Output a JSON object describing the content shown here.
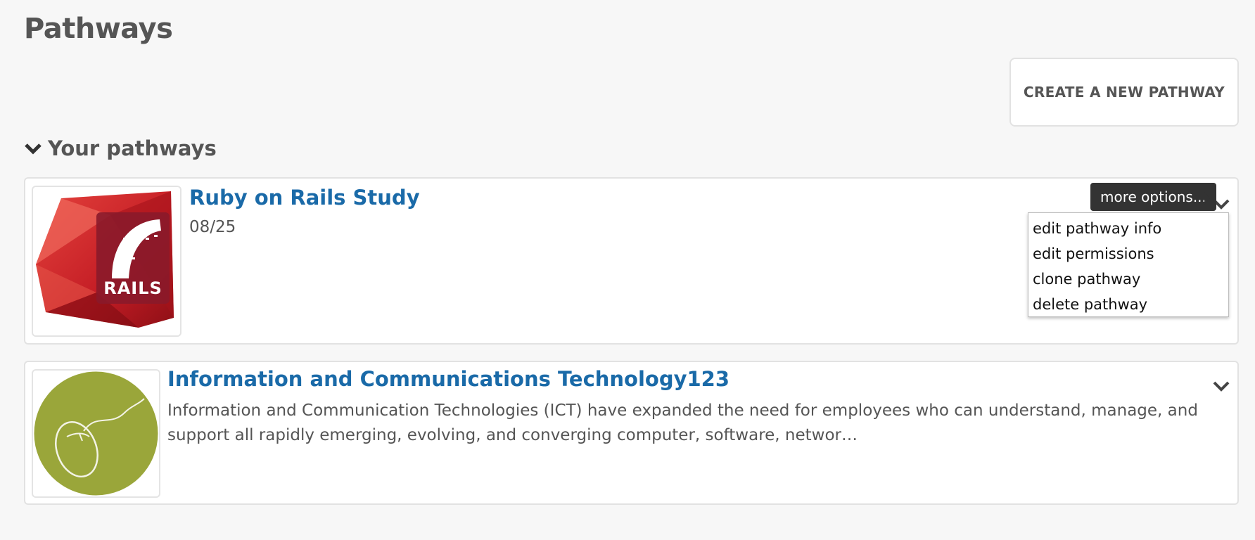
{
  "page": {
    "title": "Pathways"
  },
  "actions": {
    "create_label": "CREATE A NEW PATHWAY"
  },
  "section": {
    "heading": "Your pathways",
    "icon": "chevron-down-icon"
  },
  "pathways": [
    {
      "title": "Ruby on Rails Study",
      "date": "08/25",
      "thumbnail": "rails-logo",
      "thumbnail_text": "RAILS"
    },
    {
      "title": "Information and Communications Technology123",
      "description": "Information and Communication Technologies (ICT) have expanded the need for employees who can understand, manage, and support all rapidly emerging, evolving, and converging computer, software, networ…",
      "thumbnail": "computer-mouse-image"
    }
  ],
  "tooltip": {
    "text": "more options..."
  },
  "menu": {
    "items": [
      "edit pathway info",
      "edit permissions",
      "clone pathway",
      "delete pathway"
    ]
  },
  "colors": {
    "background": "#f7f7f7",
    "link": "#1a6aa8",
    "text": "#555555",
    "tooltip_bg": "#333333",
    "ruby_red": "#c8202a",
    "olive": "#9aa63a"
  }
}
